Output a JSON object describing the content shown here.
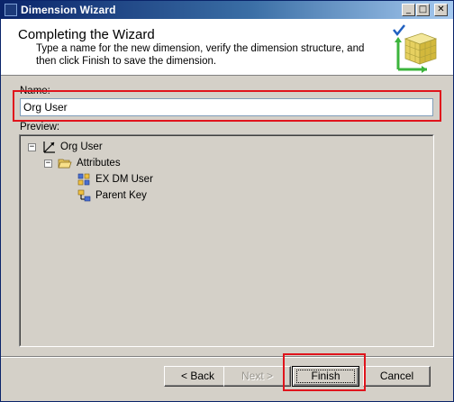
{
  "window": {
    "title": "Dimension Wizard"
  },
  "titlebar_buttons": {
    "minimize": "_",
    "maximize": "□",
    "close": "✕"
  },
  "header": {
    "title": "Completing the Wizard",
    "description": "Type a name for the new dimension, verify the dimension structure, and then click Finish to save the dimension."
  },
  "form": {
    "name_label": "Name:",
    "name_value": "Org User",
    "preview_label": "Preview:"
  },
  "tree": {
    "root": {
      "label": "Org User",
      "expander": "−"
    },
    "folder": {
      "label": "Attributes",
      "expander": "−"
    },
    "attributes": [
      {
        "label": "EX DM User",
        "icon": "key-attribute-icon"
      },
      {
        "label": "Parent Key",
        "icon": "parent-attribute-icon"
      }
    ]
  },
  "buttons": {
    "back": "< Back",
    "next": "Next >",
    "finish": "Finish",
    "cancel": "Cancel"
  },
  "colors": {
    "highlight": "#e0141c",
    "titlebar_start": "#0a246a",
    "titlebar_end": "#a6caf0",
    "dialog_bg": "#d4d0c8"
  }
}
